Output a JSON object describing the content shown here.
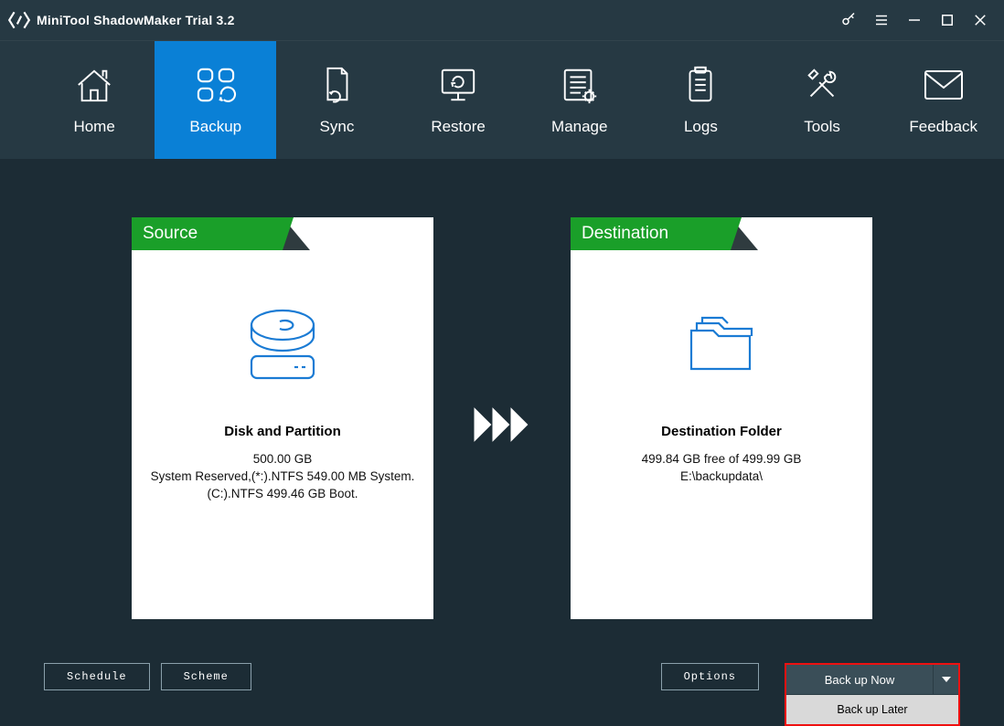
{
  "app": {
    "title": "MiniTool ShadowMaker Trial 3.2"
  },
  "nav": {
    "home": "Home",
    "backup": "Backup",
    "sync": "Sync",
    "restore": "Restore",
    "manage": "Manage",
    "logs": "Logs",
    "tools": "Tools",
    "feedback": "Feedback"
  },
  "source": {
    "header": "Source",
    "title": "Disk and Partition",
    "size": "500.00 GB",
    "line1": "System Reserved,(*:).NTFS 549.00 MB System.",
    "line2": "(C:).NTFS 499.46 GB Boot."
  },
  "destination": {
    "header": "Destination",
    "title": "Destination Folder",
    "free": "499.84 GB free of 499.99 GB",
    "path": "E:\\backupdata\\"
  },
  "footer": {
    "schedule": "Schedule",
    "scheme": "Scheme",
    "options": "Options",
    "backup_now": "Back up Now",
    "backup_later": "Back up Later"
  }
}
